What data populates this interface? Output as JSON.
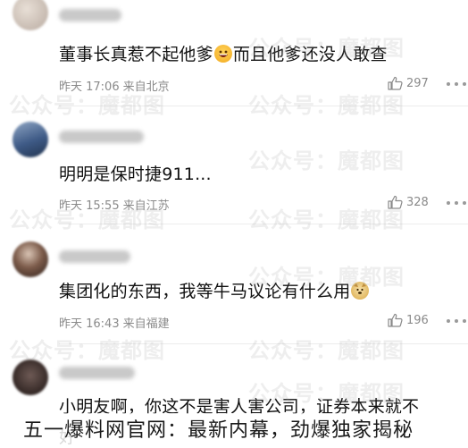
{
  "watermark": "公众号：魔都图",
  "comments": [
    {
      "text_before": "董事长真惹不起他爹",
      "emoji": "grinning-face-emoji",
      "text_after": "而且他爹还没人敢查",
      "time": "昨天 17:06",
      "location": "来自北京",
      "likes": "297"
    },
    {
      "text": "明明是保时捷911...",
      "time": "昨天 15:55",
      "location": "来自江苏",
      "likes": "328"
    },
    {
      "text_before": "集团化的东西，我等牛马议论有什么用",
      "emoji": "doge-emoji",
      "time": "昨天 16:43",
      "location": "来自福建",
      "likes": "196"
    },
    {
      "text": "小明友啊，你这不是害人害公司，证券本来就不",
      "subtext": "好"
    }
  ],
  "banner": "五一爆料网官网：最新内幕，劲爆独家揭秘",
  "colors": {
    "text": "#111111",
    "meta": "#8a8a8a",
    "divider": "#ececec"
  }
}
